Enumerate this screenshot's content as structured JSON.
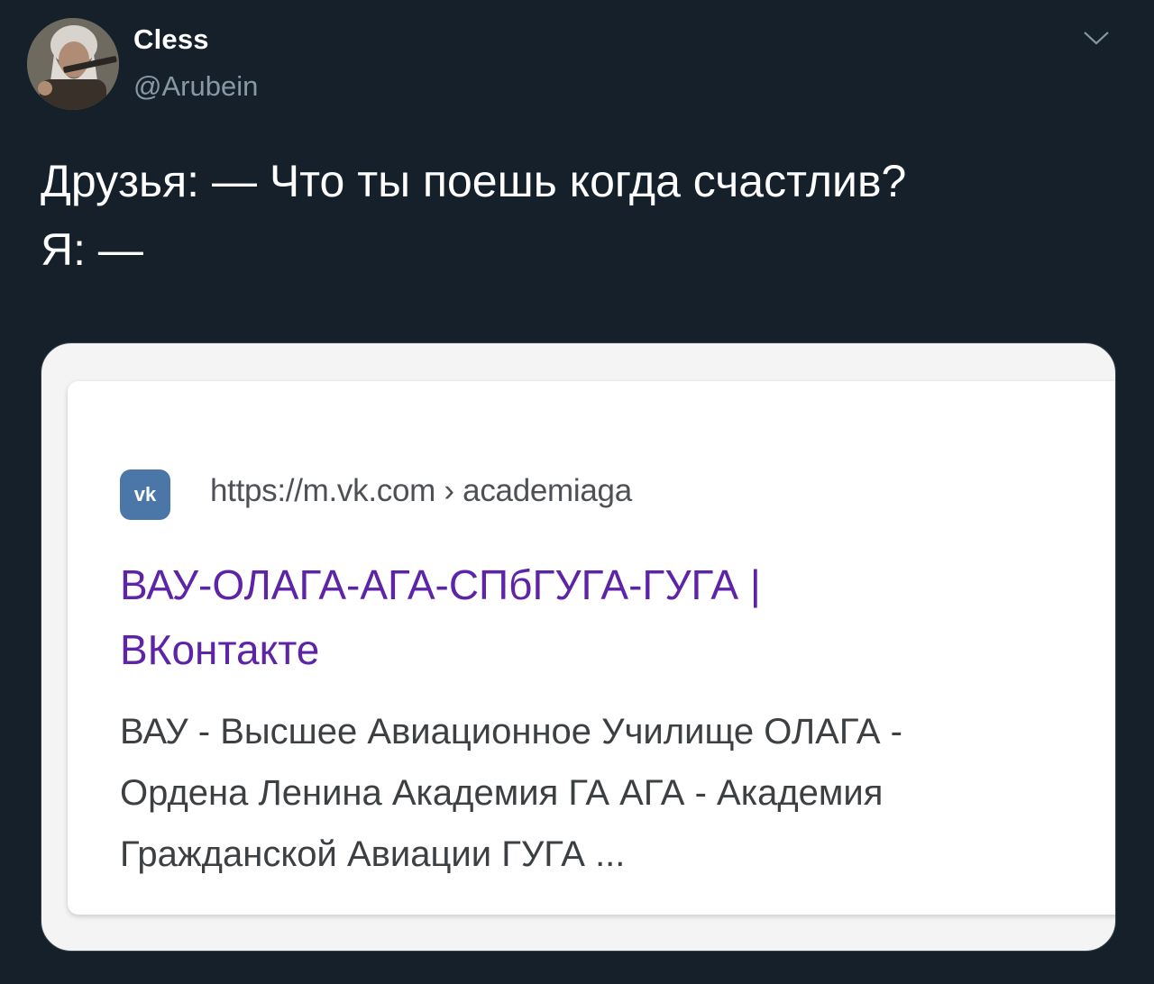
{
  "tweet": {
    "display_name": "Cless",
    "handle": "@Arubein",
    "text": "Друзья: — Что ты поешь когда счастлив?\nЯ: —",
    "avatar_icon": "user-avatar-photo",
    "menu_icon": "chevron-down-icon"
  },
  "media": {
    "search_result": {
      "logo_text": "vk",
      "url": "https://m.vk.com › academiaga",
      "title": "ВАУ-ОЛАГА-АГА-СПбГУГА-ГУГА |\nВКонтакте",
      "snippet": "ВАУ - Высшее Авиационное Училище ОЛАГА -\nОрдена Ленина Академия ГА АГА - Академия\nГражданской Авиации ГУГА ..."
    }
  },
  "colors": {
    "background": "#15202b",
    "text_primary": "#ffffff",
    "text_secondary": "#8899a6",
    "link_visited": "#5d24a8",
    "vk_brand": "#4a76a8"
  }
}
